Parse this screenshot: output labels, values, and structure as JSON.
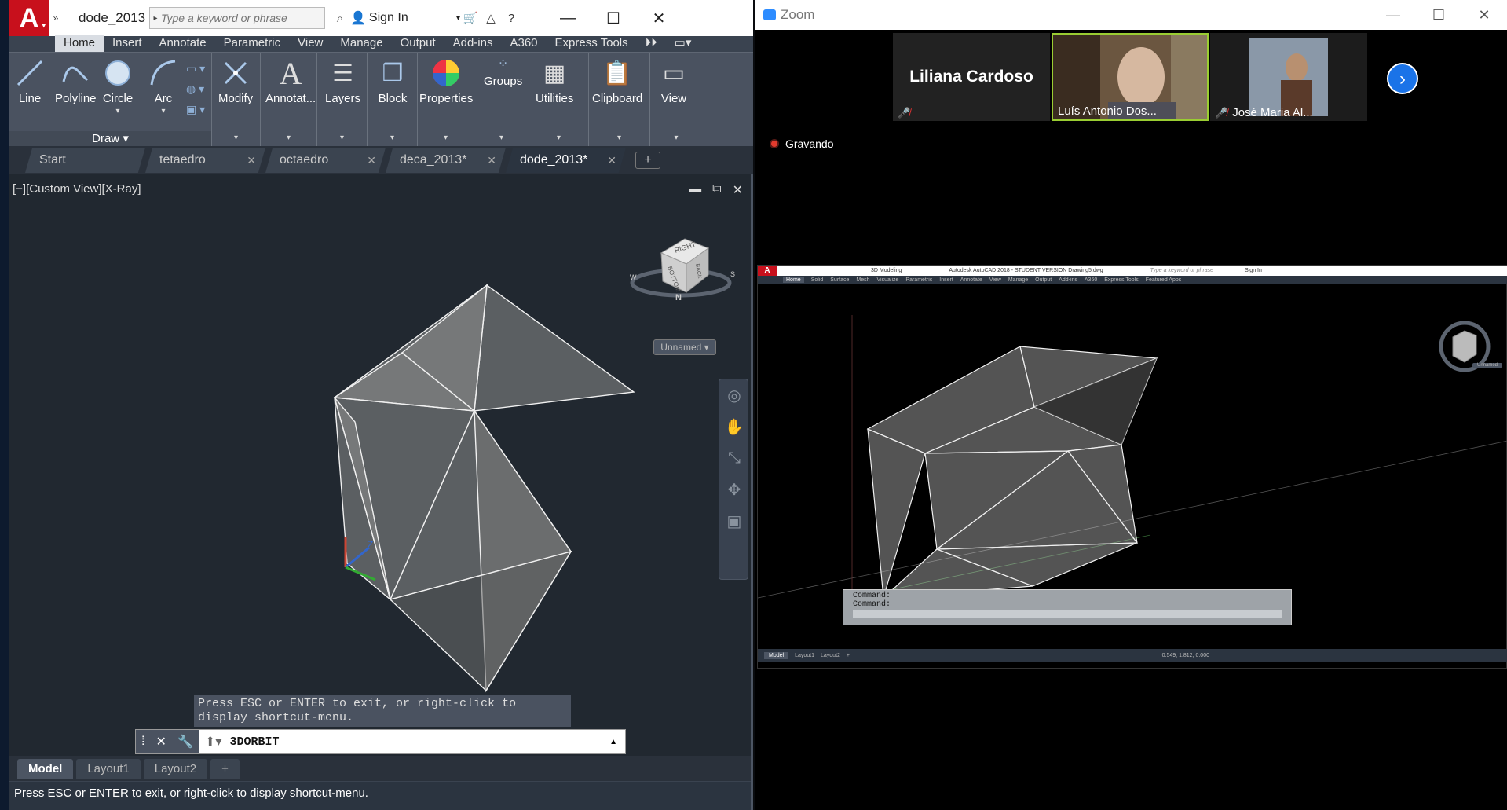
{
  "acad": {
    "doc_title": "dode_2013....",
    "search_placeholder": "Type a keyword or phrase",
    "sign_in": "Sign In",
    "ribbon_tabs": [
      "Home",
      "Insert",
      "Annotate",
      "Parametric",
      "View",
      "Manage",
      "Output",
      "Add-ins",
      "A360",
      "Express Tools"
    ],
    "tools": {
      "line": "Line",
      "polyline": "Polyline",
      "circle": "Circle",
      "arc": "Arc",
      "modify": "Modify",
      "annotate": "Annotat...",
      "layers": "Layers",
      "block": "Block",
      "properties": "Properties",
      "groups": "Groups",
      "utilities": "Utilities",
      "clipboard": "Clipboard",
      "view": "View"
    },
    "draw_panel": "Draw",
    "file_tabs": [
      {
        "label": "Start"
      },
      {
        "label": "tetaedro"
      },
      {
        "label": "octaedro"
      },
      {
        "label": "deca_2013*"
      },
      {
        "label": "dode_2013*"
      }
    ],
    "viewport_label": "[−][Custom View][X-Ray]",
    "viewcube_label": "Unnamed",
    "viewcube_faces": {
      "top": "RIGHT",
      "front": "BOTTOM",
      "side": "BACK",
      "compass_n": "N",
      "compass_w": "W",
      "compass_s": "S"
    },
    "tooltip": "Press ESC or ENTER to exit, or right-click to display shortcut-menu.",
    "command": "3DORBIT",
    "layout_tabs": [
      "Model",
      "Layout1",
      "Layout2"
    ],
    "status": "Press ESC or ENTER to exit, or right-click to display shortcut-menu."
  },
  "zoom": {
    "title": "Zoom",
    "participants": [
      {
        "name": "Liliana Cardoso",
        "muted": true
      },
      {
        "name": "Luís Antonio Dos...",
        "muted": false
      },
      {
        "name": "José Maria Al...",
        "muted": true
      }
    ],
    "recording": "Gravando",
    "shared": {
      "title": "Autodesk AutoCAD 2018 - STUDENT VERSION    Drawing5.dwg",
      "workspace": "3D Modeling",
      "search_placeholder": "Type a keyword or phrase",
      "sign_in": "Sign In",
      "tabs": [
        "Home",
        "Solid",
        "Surface",
        "Mesh",
        "Visualize",
        "Parametric",
        "Insert",
        "Annotate",
        "View",
        "Manage",
        "Output",
        "Add-ins",
        "A360",
        "Express Tools",
        "Featured Apps"
      ],
      "command_lines": [
        "Command:",
        "Command:"
      ],
      "layout_tabs": [
        "Model",
        "Layout1",
        "Layout2"
      ],
      "coords": "0.549, 1.812, 0.000",
      "viewcube_label": "Unnamed"
    }
  },
  "colors": {
    "autocad_red": "#c8101c",
    "zoom_blue": "#2d8cff",
    "viewport_bg": "#212830",
    "ribbon_bg": "#4a5260"
  }
}
